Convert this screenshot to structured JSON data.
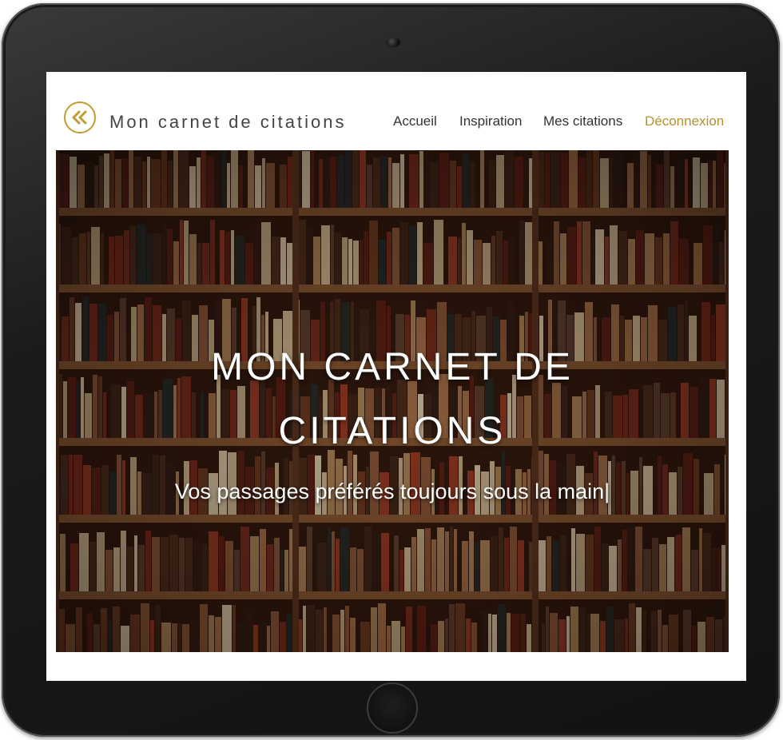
{
  "brand": {
    "name": "Mon carnet de citations",
    "logo_icon": "double-chevron-left-icon"
  },
  "nav": {
    "items": [
      {
        "label": "Accueil"
      },
      {
        "label": "Inspiration"
      },
      {
        "label": "Mes citations"
      },
      {
        "label": "Déconnexion"
      }
    ]
  },
  "hero": {
    "title_line1": "MON CARNET DE",
    "title_line2": "CITATIONS",
    "subtitle": "Vos passages préférés toujours sous la main|",
    "background": "bookshelf-photo"
  },
  "colors": {
    "accent": "#c39b2e",
    "nav_text": "#333333",
    "brand_text": "#444444"
  }
}
